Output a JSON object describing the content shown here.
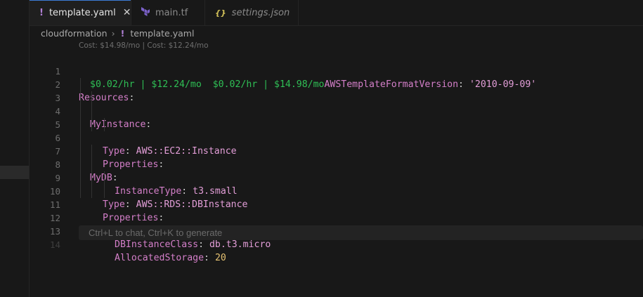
{
  "tabs": [
    {
      "icon": "!",
      "label": "template.yaml",
      "state": "active-close"
    },
    {
      "icon": "tf",
      "label": "main.tf",
      "state": "modified"
    },
    {
      "icon": "{}",
      "label": "settings.json",
      "state": "preview"
    }
  ],
  "breadcrumb": {
    "folder": "cloudformation",
    "file": "template.yaml",
    "file_icon": "!"
  },
  "codelens": "Cost: $14.98/mo | Cost: $12.24/mo",
  "lines": [
    {
      "n": "1",
      "inlay1": "$0.02/hr | $12.24/mo",
      "inlay2": "$0.02/hr | $14.98/mo",
      "key": "AWSTemplateFormatVersion",
      "colon": ": ",
      "value": "'2010-09-09'"
    },
    {
      "n": "2",
      "key": "Resources",
      "colon": ":"
    },
    {
      "n": "3",
      "key": "MyInstance",
      "colon": ":"
    },
    {
      "n": "4",
      "key": "Type",
      "colon": ": ",
      "value": "AWS::EC2::Instance"
    },
    {
      "n": "5",
      "key": "Properties",
      "colon": ":"
    },
    {
      "n": "6",
      "key": "InstanceType",
      "colon": ": ",
      "value": "t3.small"
    },
    {
      "n": "7",
      "key": "MyDB",
      "colon": ":"
    },
    {
      "n": "8",
      "key": "Type",
      "colon": ": ",
      "value": "AWS::RDS::DBInstance"
    },
    {
      "n": "9",
      "key": "Properties",
      "colon": ":"
    },
    {
      "n": "10",
      "key": "DBInstanceClass",
      "colon": ": ",
      "value": "db.t3.micro"
    },
    {
      "n": "11",
      "key": "AllocatedStorage",
      "colon": ": ",
      "value": "20"
    },
    {
      "n": "12"
    },
    {
      "n": "13"
    },
    {
      "n": "14"
    }
  ],
  "chat_hint": "Ctrl+L to chat, Ctrl+K to generate"
}
